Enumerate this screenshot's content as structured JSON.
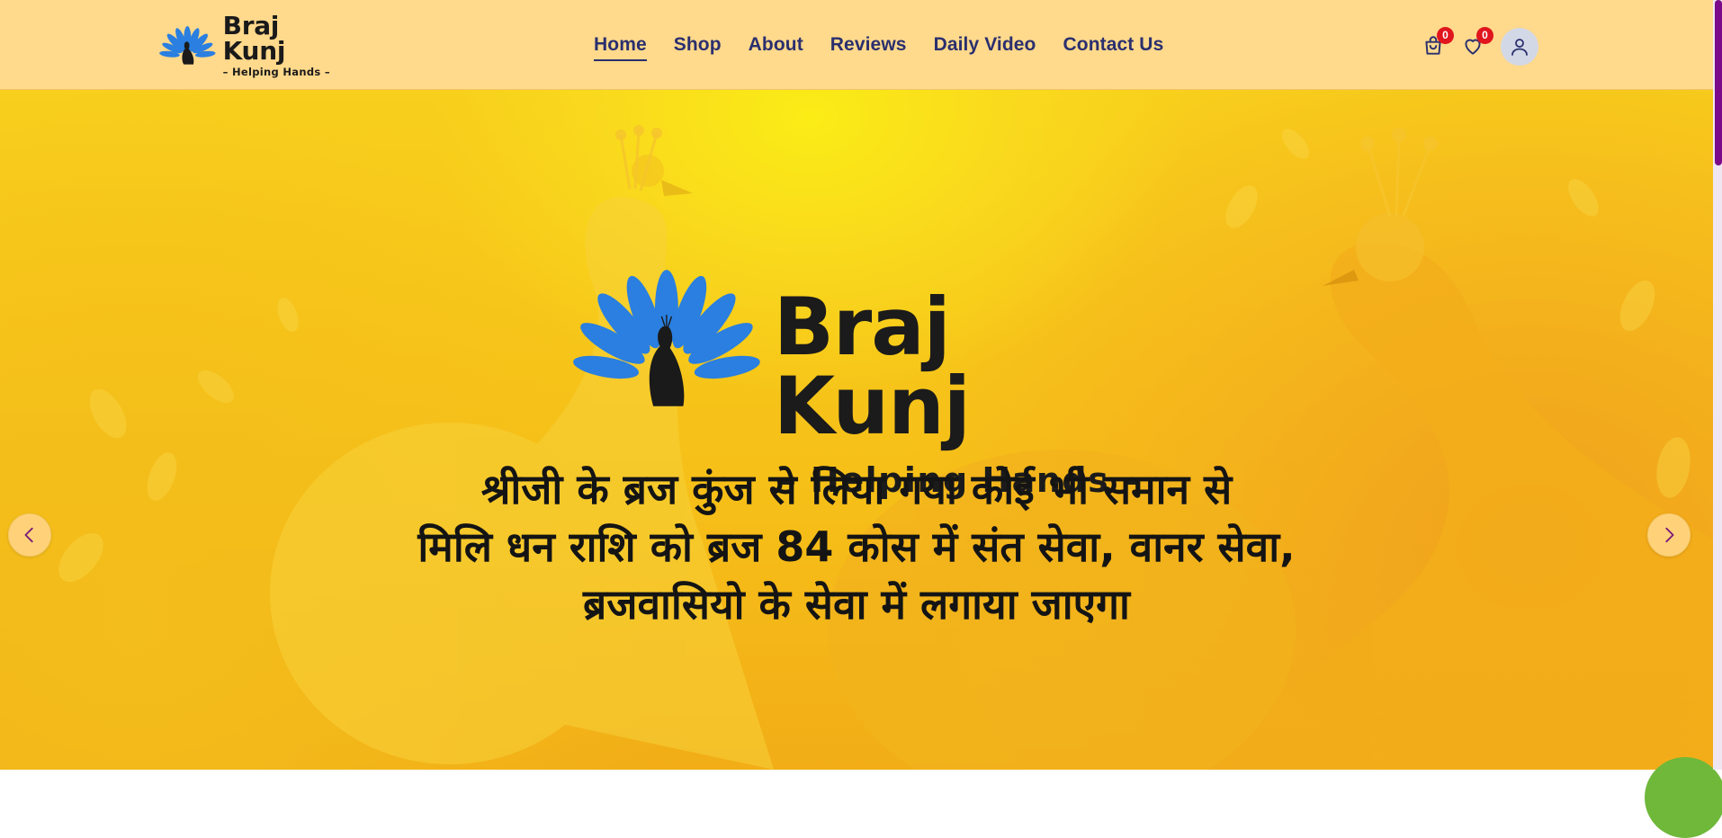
{
  "brand": {
    "name": "Braj Kunj",
    "tagline": "– Helping Hands –"
  },
  "nav": {
    "items": [
      {
        "label": "Home",
        "active": true
      },
      {
        "label": "Shop",
        "active": false
      },
      {
        "label": "About",
        "active": false
      },
      {
        "label": "Reviews",
        "active": false
      },
      {
        "label": "Daily Video",
        "active": false
      },
      {
        "label": "Contact Us",
        "active": false
      }
    ]
  },
  "header_icons": {
    "cart_count": "0",
    "wishlist_count": "0",
    "cart_icon": "shopping-bag-icon",
    "wishlist_icon": "heart-icon",
    "account_icon": "user-icon"
  },
  "hero": {
    "logo_title": "Braj Kunj",
    "logo_subtitle": "– Helping Hands –",
    "lines": [
      "श्रीजी के ब्रज कुंज से लिया गया कोई भी समान से",
      "मिलि धन राशि को ब्रज 84 कोस में संत सेवा, वानर सेवा,",
      "ब्रजवासियो के सेवा में लगाया जाएगा"
    ],
    "prev_icon": "chevron-left-icon",
    "next_icon": "chevron-right-icon"
  },
  "colors": {
    "header_bg": "#ffd98c",
    "nav_text": "#2a2f6e",
    "badge": "#e0151d",
    "feather_blue": "#2a7fe0",
    "hero_yellow": "#f8cf1c"
  }
}
